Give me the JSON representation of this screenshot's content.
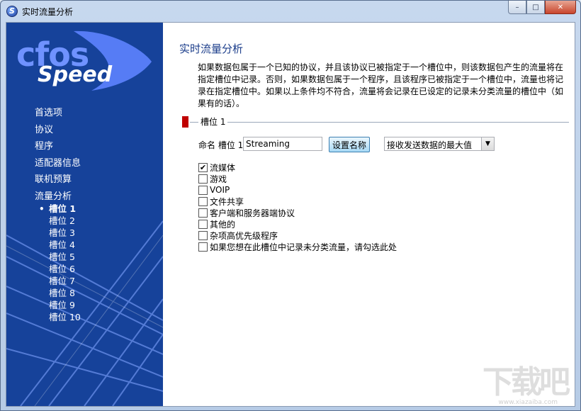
{
  "window": {
    "title": "实时流量分析",
    "minimize_glyph": "–",
    "maximize_glyph": "□",
    "close_glyph": "✕"
  },
  "logo": {
    "top": "cfos",
    "bottom": "Speed"
  },
  "sidebar": {
    "items": [
      {
        "label": "首选项"
      },
      {
        "label": "协议"
      },
      {
        "label": "程序"
      },
      {
        "label": "适配器信息"
      },
      {
        "label": "联机预算"
      },
      {
        "label": "流量分析"
      }
    ],
    "sub_items": [
      {
        "label": "槽位 1",
        "active": true
      },
      {
        "label": "槽位 2"
      },
      {
        "label": "槽位 3"
      },
      {
        "label": "槽位 4"
      },
      {
        "label": "槽位 5"
      },
      {
        "label": "槽位 6"
      },
      {
        "label": "槽位 7"
      },
      {
        "label": "槽位 8"
      },
      {
        "label": "槽位 9"
      },
      {
        "label": "槽位 10"
      }
    ],
    "bullet": "•"
  },
  "main": {
    "title": "实时流量分析",
    "description": "如果数据包属于一个已知的协议，并且该协议已被指定于一个槽位中，则该数据包产生的流量将在指定槽位中记录。否则，如果数据包属于一个程序，且该程序已被指定于一个槽位中，流量也将记录在指定槽位中。如果以上条件均不符合，流量将会记录在已设定的记录未分类流量的槽位中（如果有的话）。",
    "group_label": "槽位 1",
    "name_label": "命名 槽位 1",
    "name_value": "Streaming",
    "set_name_button": "设置名称",
    "select_value": "接收发送数据的最大值",
    "select_arrow": "▼",
    "check_mark": "✔",
    "checkboxes": [
      {
        "label": "流媒体",
        "checked": true
      },
      {
        "label": "游戏",
        "checked": false
      },
      {
        "label": "VOIP",
        "checked": false
      },
      {
        "label": "文件共享",
        "checked": false
      },
      {
        "label": "客户端和服务器端协议",
        "checked": false
      },
      {
        "label": "其他的",
        "checked": false
      },
      {
        "label": "杂项高优先级程序",
        "checked": false
      },
      {
        "label": "如果您想在此槽位中记录未分类流量，请勾选此处",
        "checked": false
      }
    ]
  },
  "watermark": {
    "main": "下载吧",
    "sub": "www.xiazaiba.com"
  },
  "colors": {
    "sidebar_bg": "#16429a",
    "logo_blue": "#6f92ff",
    "title_blue": "#1a3c8a",
    "group_marker": "#c00000"
  }
}
